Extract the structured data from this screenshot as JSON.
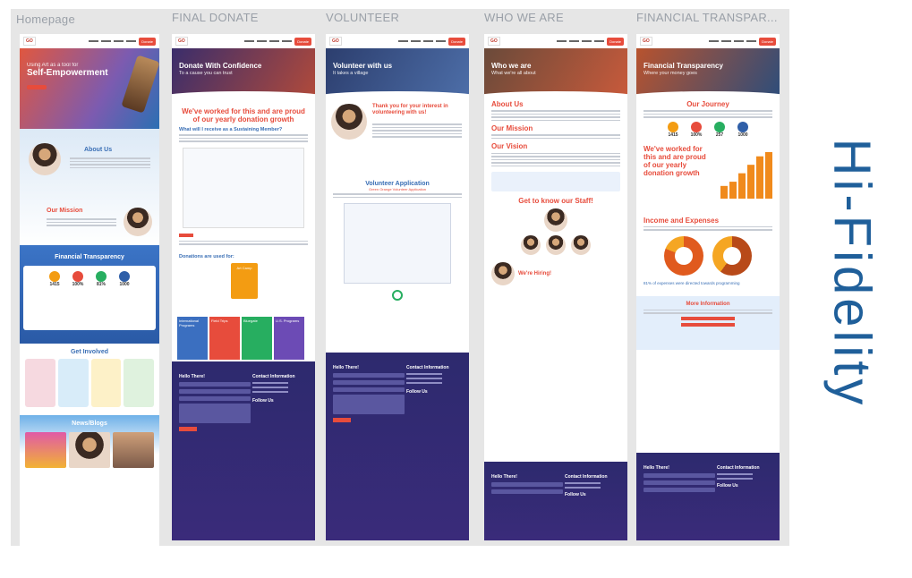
{
  "labels": {
    "homepage": "Homepage",
    "final_donate": "FINAL DONATE",
    "volunteer": "VOLUNTEER",
    "who_we_are": "WHO WE ARE",
    "financial": "FINANCIAL TRANSPAR..."
  },
  "hifi": "Hi-Fidelity",
  "homepage": {
    "hero_title": "Using Art as a tool for",
    "hero_title2": "Self-Empowerment",
    "about": "About Us",
    "mission": "Our Mission",
    "financial": "Financial Transparency",
    "stats": [
      {
        "n": "1415",
        "color": "#f39c12"
      },
      {
        "n": "100%",
        "color": "#e74c3c"
      },
      {
        "n": "81%",
        "color": "#27ae60"
      },
      {
        "n": "1000",
        "color": "#2f5fa8"
      }
    ],
    "get_involved": "Get Involved",
    "news": "News/Blogs"
  },
  "donate": {
    "hero_title": "Donate With Confidence",
    "hero_sub": "To a cause you can trust",
    "heading": "We've worked for this and are proud of our yearly donation growth",
    "question": "What will I receive as a Sustaining Member?",
    "used_for": "Donations are used for:",
    "tags": [
      "International Programs",
      "Field Trips",
      "Bluegate",
      "U.S. Programs",
      "Art Camp"
    ]
  },
  "volunteer": {
    "hero_title": "Volunteer with us",
    "hero_sub": "It takes a village",
    "heading": "Thank you for your interest in volunteering with us!",
    "app": "Volunteer Application",
    "app_sub": "Green Orange Volunteer Application"
  },
  "who": {
    "hero_title": "Who we are",
    "hero_sub": "What we're all about",
    "about": "About Us",
    "mission": "Our Mission",
    "vision": "Our Vision",
    "staff": "Get to know our Staff!",
    "hiring": "We're Hiring!"
  },
  "fin": {
    "hero_title": "Financial Transparency",
    "hero_sub": "Where your money goes",
    "journey": "Our Journey",
    "stats": [
      "1415",
      "100%",
      "257",
      "1000"
    ],
    "heading": "We've worked for this and are proud of our yearly donation growth",
    "income": "Income and Expenses",
    "pct": "81% of expenses were directed towards programming",
    "more": "More Information"
  },
  "footer": {
    "hello": "Hello There!",
    "contact": "Contact Information",
    "follow": "Follow Us",
    "submit": "SUBMIT"
  },
  "chart_growth": [
    3,
    4,
    6,
    8,
    10,
    11
  ]
}
